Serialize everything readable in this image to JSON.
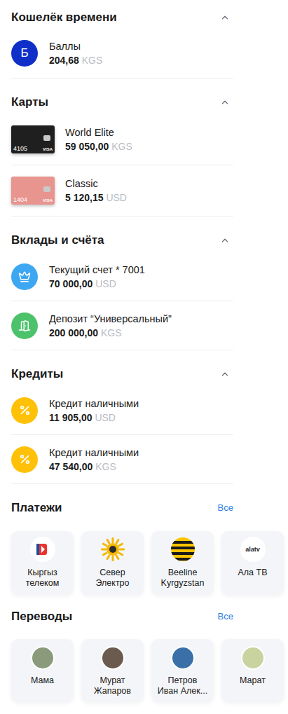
{
  "sections": [
    {
      "title": "Кошелёк времени",
      "expanded": true,
      "items": [
        {
          "kind": "points",
          "icon_text": "Б",
          "name": "Баллы",
          "amount": "204,68",
          "currency": "KGS",
          "color": "#0f2fc8"
        }
      ]
    },
    {
      "title": "Карты",
      "expanded": true,
      "items": [
        {
          "kind": "card",
          "name": "World Elite",
          "amount": "59 050,00",
          "currency": "KGS",
          "last4": "4105",
          "brand": "VISA",
          "color": "#1f1f1f"
        },
        {
          "kind": "card",
          "name": "Classic",
          "amount": "5 120,15",
          "currency": "USD",
          "last4": "1404",
          "brand": "VISA",
          "color": "#e8948f"
        }
      ]
    },
    {
      "title": "Вклады и счёта",
      "expanded": true,
      "items": [
        {
          "kind": "account",
          "name": "Текущий счет * 7001",
          "amount": "70 000,00",
          "currency": "USD",
          "color": "#3ea7f2"
        },
        {
          "kind": "deposit",
          "name": "Депозит “Универсальный”",
          "amount": "200 000,00",
          "currency": "KGS",
          "color": "#4cc36b"
        }
      ]
    },
    {
      "title": "Кредиты",
      "expanded": true,
      "items": [
        {
          "kind": "loan",
          "name": "Кредит наличными",
          "amount": "11 905,00",
          "currency": "USD",
          "color": "#ffc107"
        },
        {
          "kind": "loan",
          "name": "Кредит наличными",
          "amount": "47 540,00",
          "currency": "KGS",
          "color": "#ffc107"
        }
      ]
    }
  ],
  "payments": {
    "title": "Платежи",
    "link": "Все",
    "items": [
      {
        "kind": "kyrgyztelecom",
        "lines": [
          "Кыргыз",
          "телеком"
        ]
      },
      {
        "kind": "sun",
        "lines": [
          "Север",
          "Электро"
        ]
      },
      {
        "kind": "beeline",
        "lines": [
          "Beeline",
          "Kyrgyzstan"
        ]
      },
      {
        "kind": "alatv",
        "logo_text": "alatv",
        "lines": [
          "Ала ТВ"
        ]
      }
    ]
  },
  "transfers": {
    "title": "Переводы",
    "link": "Все",
    "items": [
      {
        "lines": [
          "Мама"
        ],
        "color": "#8a9a7a"
      },
      {
        "lines": [
          "Мурат",
          "Жапаров"
        ],
        "color": "#6b5a4e"
      },
      {
        "lines": [
          "Петров",
          "Иван Алек..."
        ],
        "color": "#3a6fa8"
      },
      {
        "lines": [
          "Марат"
        ],
        "color": "#c9d3a0"
      }
    ]
  }
}
